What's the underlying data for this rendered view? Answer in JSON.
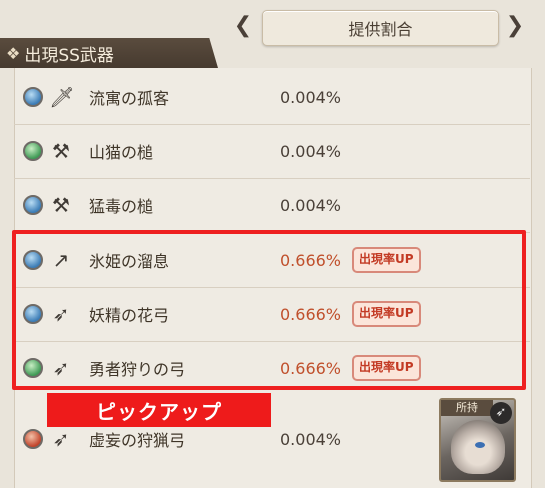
{
  "header": {
    "tab_label": "提供割合",
    "prev_symbol": "❮",
    "next_symbol": "❯"
  },
  "section": {
    "title": "出現SS武器",
    "icon": "❖"
  },
  "rows": [
    {
      "element": "water",
      "weapon_icon": "sword-icon",
      "weapon_glyph": "🗡",
      "name": "流寓の孤客",
      "rate": "0.004%",
      "badge": ""
    },
    {
      "element": "wind",
      "weapon_icon": "hammer-icon",
      "weapon_glyph": "⚒",
      "name": "山猫の槌",
      "rate": "0.004%",
      "badge": ""
    },
    {
      "element": "water",
      "weapon_icon": "hammer-icon",
      "weapon_glyph": "⚒",
      "name": "猛毒の槌",
      "rate": "0.004%",
      "badge": ""
    },
    {
      "element": "water",
      "weapon_icon": "spear-icon",
      "weapon_glyph": "↗",
      "name": "氷姫の溜息",
      "rate": "0.666%",
      "badge": "出現率UP"
    },
    {
      "element": "water",
      "weapon_icon": "bow-icon",
      "weapon_glyph": "➶",
      "name": "妖精の花弓",
      "rate": "0.666%",
      "badge": "出現率UP"
    },
    {
      "element": "wind",
      "weapon_icon": "bow-icon",
      "weapon_glyph": "➶",
      "name": "勇者狩りの弓",
      "rate": "0.666%",
      "badge": "出現率UP"
    },
    {
      "element": "fire",
      "weapon_icon": "bow-icon",
      "weapon_glyph": "➶",
      "name": "虚妄の狩猟弓",
      "rate": "0.004%",
      "badge": ""
    }
  ],
  "pickup_label": "ピックアップ",
  "owned": {
    "label": "所持",
    "icon_glyph": "➶"
  },
  "colors": {
    "highlight": "#ee2020",
    "up_rate": "#c0502c",
    "badge_text": "#c33a24"
  }
}
